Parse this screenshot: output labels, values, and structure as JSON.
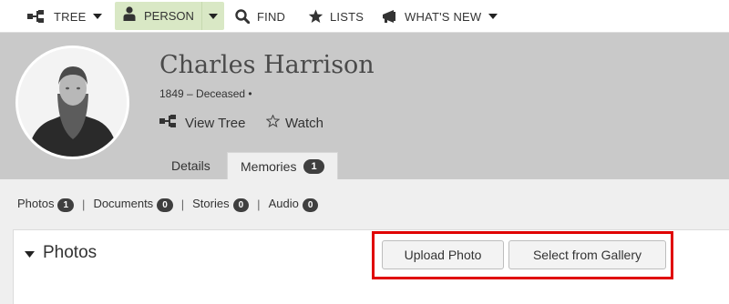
{
  "nav": {
    "tree_label": "TREE",
    "person_label": "PERSON",
    "find_label": "FIND",
    "lists_label": "LISTS",
    "whats_new_label": "WHAT'S NEW"
  },
  "profile": {
    "name": "Charles Harrison",
    "lifespan": "1849 – Deceased •",
    "view_tree_label": "View Tree",
    "watch_label": "Watch"
  },
  "tabs": [
    {
      "label": "Details"
    },
    {
      "label": "Memories",
      "count": "1",
      "active": true
    }
  ],
  "subnav": [
    {
      "label": "Photos",
      "count": "1"
    },
    {
      "label": "Documents",
      "count": "0"
    },
    {
      "label": "Stories",
      "count": "0"
    },
    {
      "label": "Audio",
      "count": "0"
    }
  ],
  "photos_panel": {
    "title": "Photos",
    "upload_label": "Upload Photo",
    "gallery_label": "Select from Gallery"
  },
  "colors": {
    "person_tab_bg": "#d9e8c5",
    "header_bg": "#c9c9c9",
    "highlight": "#e00000",
    "badge": "#3f3f3f"
  }
}
